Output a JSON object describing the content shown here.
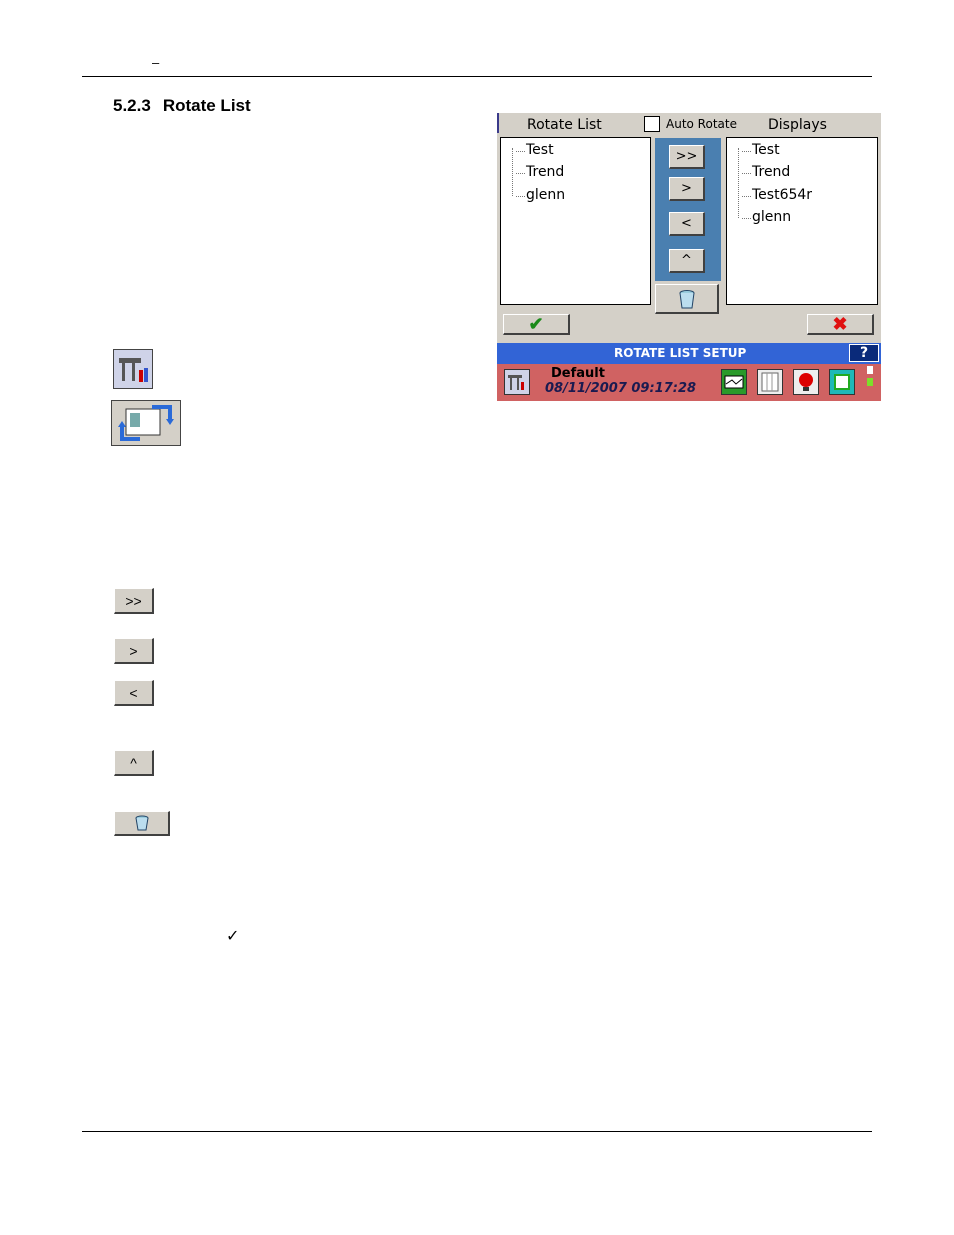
{
  "header": {
    "dash": "–"
  },
  "section": {
    "number": "5.2.3",
    "title": "Rotate List"
  },
  "left_icons": [
    {
      "name": "setup-icon"
    },
    {
      "name": "rotate-list-icon"
    }
  ],
  "button_legend": [
    {
      "label": ">>"
    },
    {
      "label": ">"
    },
    {
      "label": "<"
    },
    {
      "label": "^"
    },
    {
      "name": "delete-icon"
    }
  ],
  "check_symbol": "✓",
  "screenshot": {
    "rotate_list_label": "Rotate List",
    "auto_rotate_label": "Auto Rotate",
    "displays_label": "Displays",
    "rotate_items": [
      "Test",
      "Trend",
      "glenn"
    ],
    "display_items": [
      "Test",
      "Trend",
      "Test654r",
      "glenn"
    ],
    "buttons": {
      "add_all": ">>",
      "add": ">",
      "remove": "<",
      "up": "^"
    },
    "ok_symbol": "✔",
    "cancel_symbol": "✖",
    "title": "ROTATE LIST SETUP",
    "help": "?",
    "status": {
      "name": "Default",
      "datetime": "08/11/2007 09:17:28"
    },
    "colors": {
      "title_bar": "#3264d6",
      "status_bar": "#d06262",
      "button_panel": "#4a7fb0",
      "ok": "#1a8a1a",
      "cancel": "#e01010"
    }
  }
}
